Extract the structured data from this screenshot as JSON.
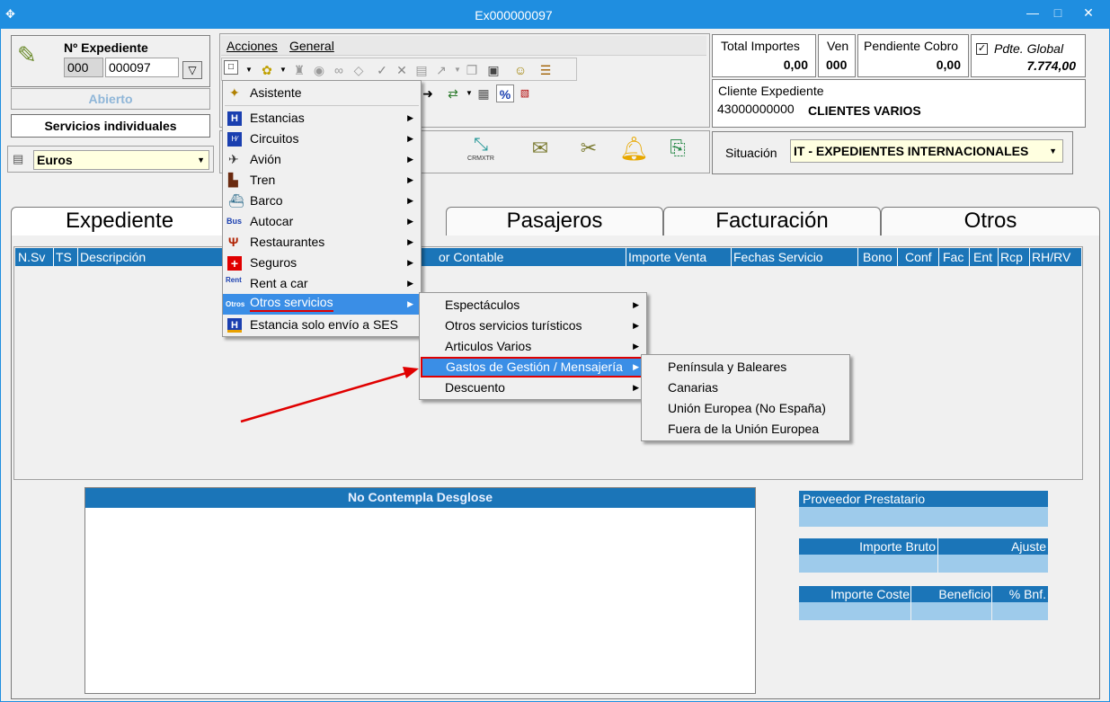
{
  "window": {
    "title": "Ex000000097",
    "min": "—",
    "max": "□",
    "close": "✕"
  },
  "expediente": {
    "label": "Nº Expediente",
    "serie": "000",
    "numero": "000097",
    "estado": "Abierto",
    "tipo": "Servicios individuales"
  },
  "moneda": {
    "value": "Euros"
  },
  "menubar": {
    "acciones": "Acciones",
    "general": "General"
  },
  "totales": {
    "total_importes_label": "Total Importes",
    "total_importes": "0,00",
    "ven_label": "Ven",
    "ven": "000",
    "pendiente_label": "Pendiente Cobro",
    "pendiente": "0,00",
    "pdte_global_label": "Pdte. Global",
    "pdte_global": "7.774,00"
  },
  "cliente": {
    "label": "Cliente Expediente",
    "codigo": "43000000000",
    "nombre": "CLIENTES VARIOS"
  },
  "situacion": {
    "label": "Situación",
    "value": "IT - EXPEDIENTES INTERNACIONALES"
  },
  "toolbar2": {
    "crm_label": "CRMXTR"
  },
  "tabs": [
    "Expediente",
    "Pasajeros",
    "Facturación",
    "Otros"
  ],
  "grid": {
    "columns": [
      "N.Sv",
      "TS",
      "Descripción",
      "or Contable",
      "Importe Venta",
      "Fechas Servicio",
      "Bono",
      "Conf",
      "Fac",
      "Ent",
      "Rcp",
      "RH/RV"
    ]
  },
  "desglose": {
    "title": "No Contempla Desglose"
  },
  "proveedor": {
    "label": "Proveedor Prestatario"
  },
  "importes": {
    "bruto": "Importe Bruto",
    "ajuste": "Ajuste",
    "coste": "Importe Coste",
    "beneficio": "Beneficio",
    "bnf": "% Bnf."
  },
  "menu1": {
    "items": [
      {
        "label": "Asistente",
        "icon": "wand-icon"
      },
      {
        "label": "Estancias",
        "icon": "hotel-icon"
      },
      {
        "label": "Circuitos",
        "icon": "circuit-icon"
      },
      {
        "label": "Avión",
        "icon": "plane-icon"
      },
      {
        "label": "Tren",
        "icon": "train-icon"
      },
      {
        "label": "Barco",
        "icon": "ship-icon"
      },
      {
        "label": "Autocar",
        "icon": "bus-icon"
      },
      {
        "label": "Restaurantes",
        "icon": "fork-knife-icon"
      },
      {
        "label": "Seguros",
        "icon": "red-cross-icon"
      },
      {
        "label": "Rent a car",
        "icon": "rent-car-icon"
      },
      {
        "label": "Otros servicios",
        "icon": "otros-icon"
      },
      {
        "label": "Estancia solo envío a SES",
        "icon": "hotel-ses-icon"
      }
    ]
  },
  "menu2": {
    "items": [
      {
        "label": "Espectáculos"
      },
      {
        "label": "Otros servicios turísticos"
      },
      {
        "label": "Articulos Varios"
      },
      {
        "label": "Gastos de Gestión / Mensajería"
      },
      {
        "label": "Descuento"
      }
    ]
  },
  "menu3": {
    "items": [
      {
        "label": "Península y Baleares"
      },
      {
        "label": "Canarias"
      },
      {
        "label": "Unión Europea (No España)"
      },
      {
        "label": "Fuera de la Unión Europea"
      }
    ]
  },
  "colors": {
    "titlebar": "#1f8ee0",
    "highlight": "#3a8ee6",
    "gridhead": "#1b75b8",
    "annotation": "#e00000"
  }
}
